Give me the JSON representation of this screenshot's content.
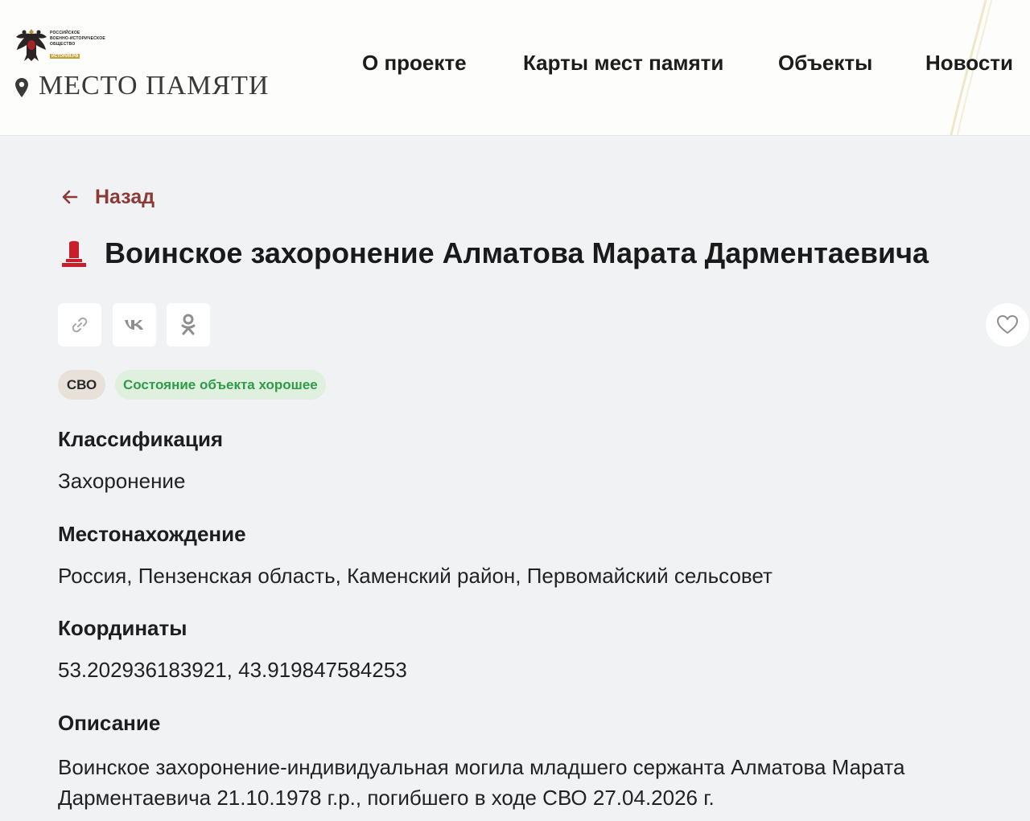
{
  "logo": {
    "org_lines": [
      "РОССИЙСКОЕ",
      "ВОЕННО-ИСТОРИЧЕСКОЕ",
      "ОБЩЕСТВО"
    ],
    "org_tag": "ИСТОРИЯ.РФ",
    "site_title": "МЕСТО ПАМЯТИ",
    "emblem_icon": "double-headed-eagle-icon",
    "pin_icon": "map-pin-icon"
  },
  "nav": {
    "about": "О проекте",
    "maps": "Карты мест памяти",
    "objects": "Объекты",
    "news": "Новости"
  },
  "back_label": "Назад",
  "page": {
    "title": "Воинское захоронение Алматова Марата Дарментаевича",
    "title_icon": "grave-monument-icon"
  },
  "share": {
    "link_icon": "link-icon",
    "vk_label": "vk",
    "ok_icon": "odnoklassniki-icon"
  },
  "favorite_icon": "heart-icon",
  "tags": {
    "category": "СВО",
    "state": "Состояние объекта хорошее"
  },
  "details": {
    "classification_label": "Классификация",
    "classification_value": "Захоронение",
    "location_label": "Местонахождение",
    "location_value": "Россия, Пензенская область, Каменский район, Первомайский сельсовет",
    "coords_label": "Координаты",
    "coords_value": "53.202936183921, 43.919847584253",
    "description_label": "Описание",
    "description_lines": [
      "Воинское захоронение-индивидуальная могила младшего сержанта Алматова Марата",
      "Дарментаевича 21.10.1978 г.р., погибшего в ходе СВО 27.04.2026 г."
    ]
  },
  "colors": {
    "accent": "#8c3a36",
    "title_icon": "#c8202a",
    "state_text": "#2f9b47",
    "state_bg": "#dff0df",
    "page_bg": "#f1f2f4"
  }
}
